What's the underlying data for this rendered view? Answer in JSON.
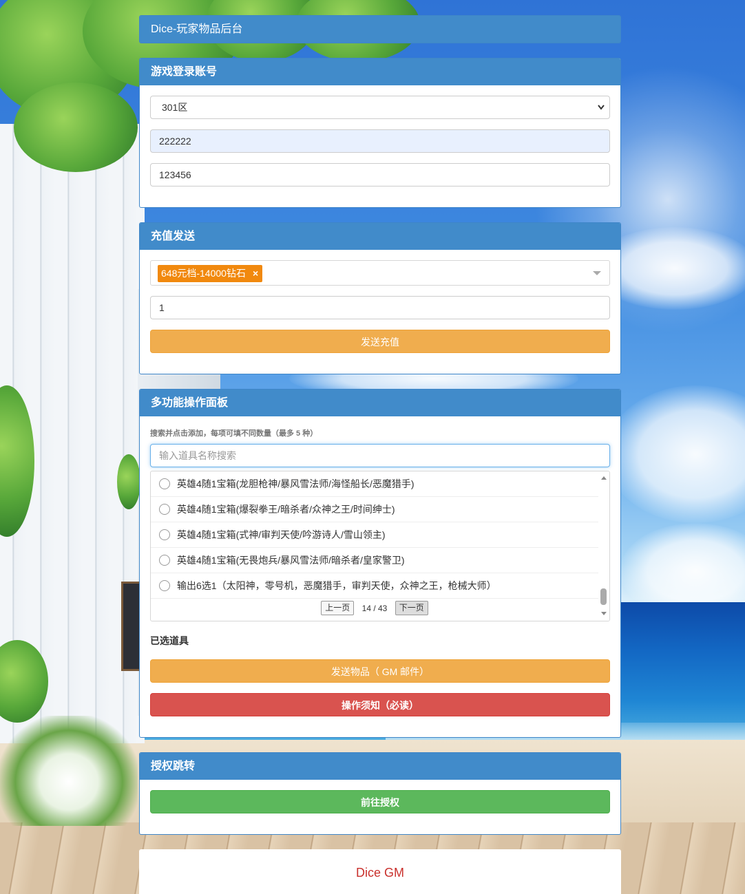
{
  "app": {
    "title": "Dice-玩家物品后台"
  },
  "login": {
    "heading": "游戏登录账号",
    "server_selected": "301区",
    "account_value": "222222",
    "password_value": "123456"
  },
  "recharge": {
    "heading": "充值发送",
    "selected_tag": "648元档-14000钻石",
    "tag_remove": "×",
    "quantity_value": "1",
    "send_button": "发送充值",
    "tag_color": "#f1890e"
  },
  "multi": {
    "heading": "多功能操作面板",
    "hint": "搜索并点击添加，每项可填不同数量（最多 5 种）",
    "search_placeholder": "输入道具名称搜索",
    "items": [
      {
        "label": "英雄4随1宝箱(龙胆枪神/暴风雪法师/海怪船长/恶魔猎手)"
      },
      {
        "label": "英雄4随1宝箱(爆裂拳王/暗杀者/众神之王/时间绅士)"
      },
      {
        "label": "英雄4随1宝箱(式神/审判天使/吟游诗人/雪山领主)"
      },
      {
        "label": "英雄4随1宝箱(无畏炮兵/暴风雪法师/暗杀者/皇家警卫)"
      },
      {
        "label": "输出6选1（太阳神，零号机，恶魔猎手，审判天使，众神之王，枪械大师）"
      }
    ],
    "pager": {
      "prev": "上一页",
      "info": "14 / 43",
      "next": "下一页"
    },
    "selected_label": "已选道具",
    "send_items_button": "发送物品（ GM 邮件）",
    "notice_button": "操作须知（必读）"
  },
  "auth": {
    "heading": "授权跳转",
    "goto_button": "前往授权"
  },
  "footer": {
    "text": "Dice GM"
  },
  "colors": {
    "panel_heading": "#418bca",
    "warning": "#f0ad4e",
    "danger": "#d9534f",
    "success": "#5cb85c",
    "footer_text": "#c9302c"
  }
}
